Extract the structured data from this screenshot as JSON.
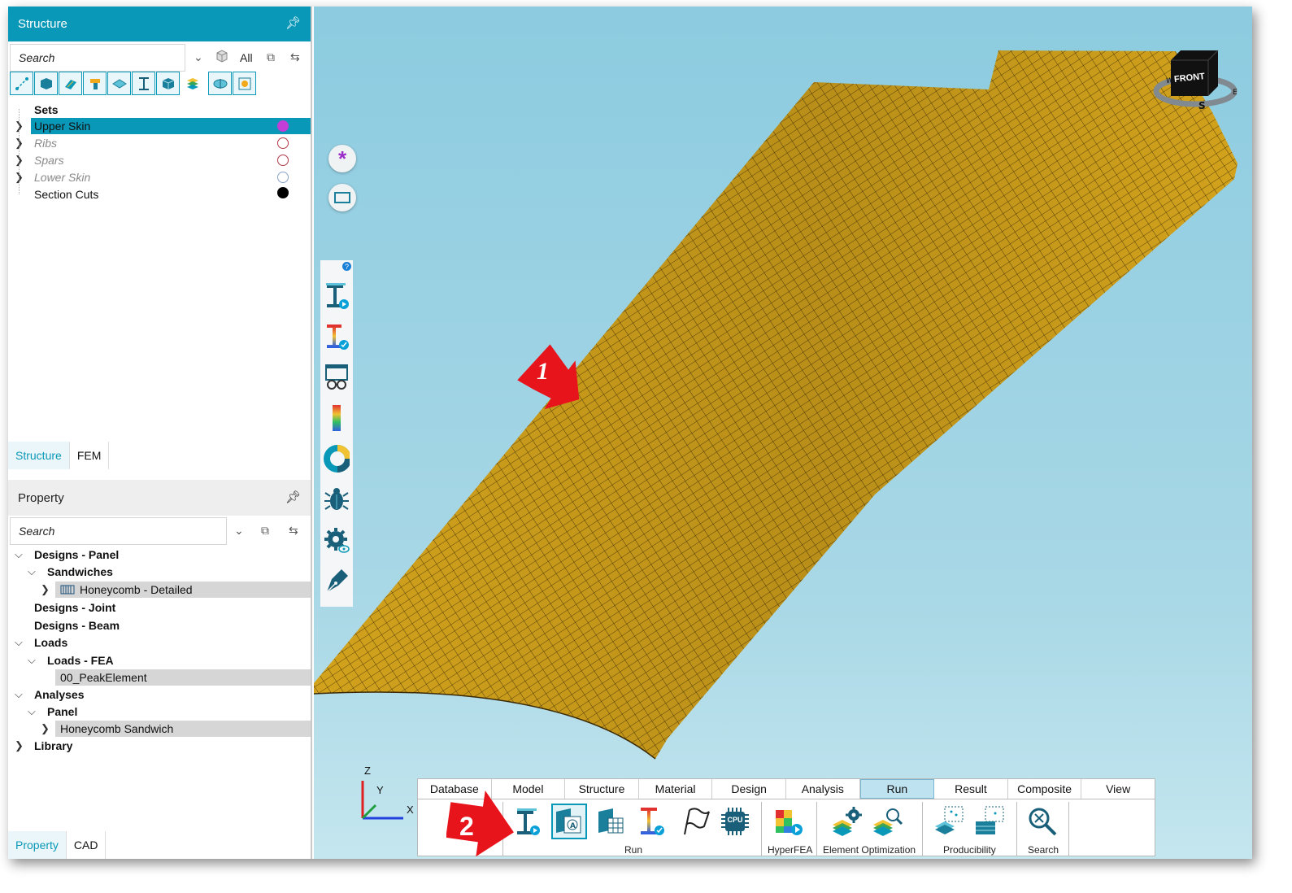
{
  "structure_panel": {
    "title": "Structure",
    "search_placeholder": "Search",
    "all_label": "All",
    "tree_items": [
      {
        "label": "Sets",
        "bold": true
      },
      {
        "label": "Upper Skin",
        "color": "#c23ed6"
      },
      {
        "label": "Ribs",
        "color": "#b03a4a"
      },
      {
        "label": "Spars",
        "color": "#b03a4a"
      },
      {
        "label": "Lower Skin",
        "color": "#8aa3c8"
      },
      {
        "label": "Section Cuts",
        "color": "#000000"
      }
    ],
    "tabs": [
      "Structure",
      "FEM"
    ]
  },
  "property_panel": {
    "title": "Property",
    "search_placeholder": "Search",
    "tree_items": [
      {
        "label": "Designs - Panel"
      },
      {
        "label": "Sandwiches"
      },
      {
        "label": "Honeycomb - Detailed"
      },
      {
        "label": "Designs - Joint"
      },
      {
        "label": "Designs - Beam"
      },
      {
        "label": "Loads"
      },
      {
        "label": "Loads - FEA"
      },
      {
        "label": "00_PeakElement"
      },
      {
        "label": "Analyses"
      },
      {
        "label": "Panel"
      },
      {
        "label": "Honeycomb Sandwich"
      },
      {
        "label": "Library"
      }
    ],
    "tabs": [
      "Property",
      "CAD"
    ]
  },
  "viewport": {
    "nav_cube_label": "FRONT",
    "callout_1": "1",
    "callout_2": "2",
    "axes": {
      "x": "X",
      "y": "Y",
      "z": "Z"
    }
  },
  "ribbon": {
    "tabs": [
      "Database",
      "Model",
      "Structure",
      "Material",
      "Design",
      "Analysis",
      "Run",
      "Result",
      "Composite",
      "View"
    ],
    "active_tab": "Run",
    "groups": [
      "Run",
      "HyperFEA",
      "Element Optimization",
      "Producibility",
      "Search"
    ],
    "cpu_label": "CPU"
  },
  "colors": {
    "accent": "#0a98b8",
    "mesh_fill": "#d2a21c",
    "callout_red": "#e8141c"
  }
}
